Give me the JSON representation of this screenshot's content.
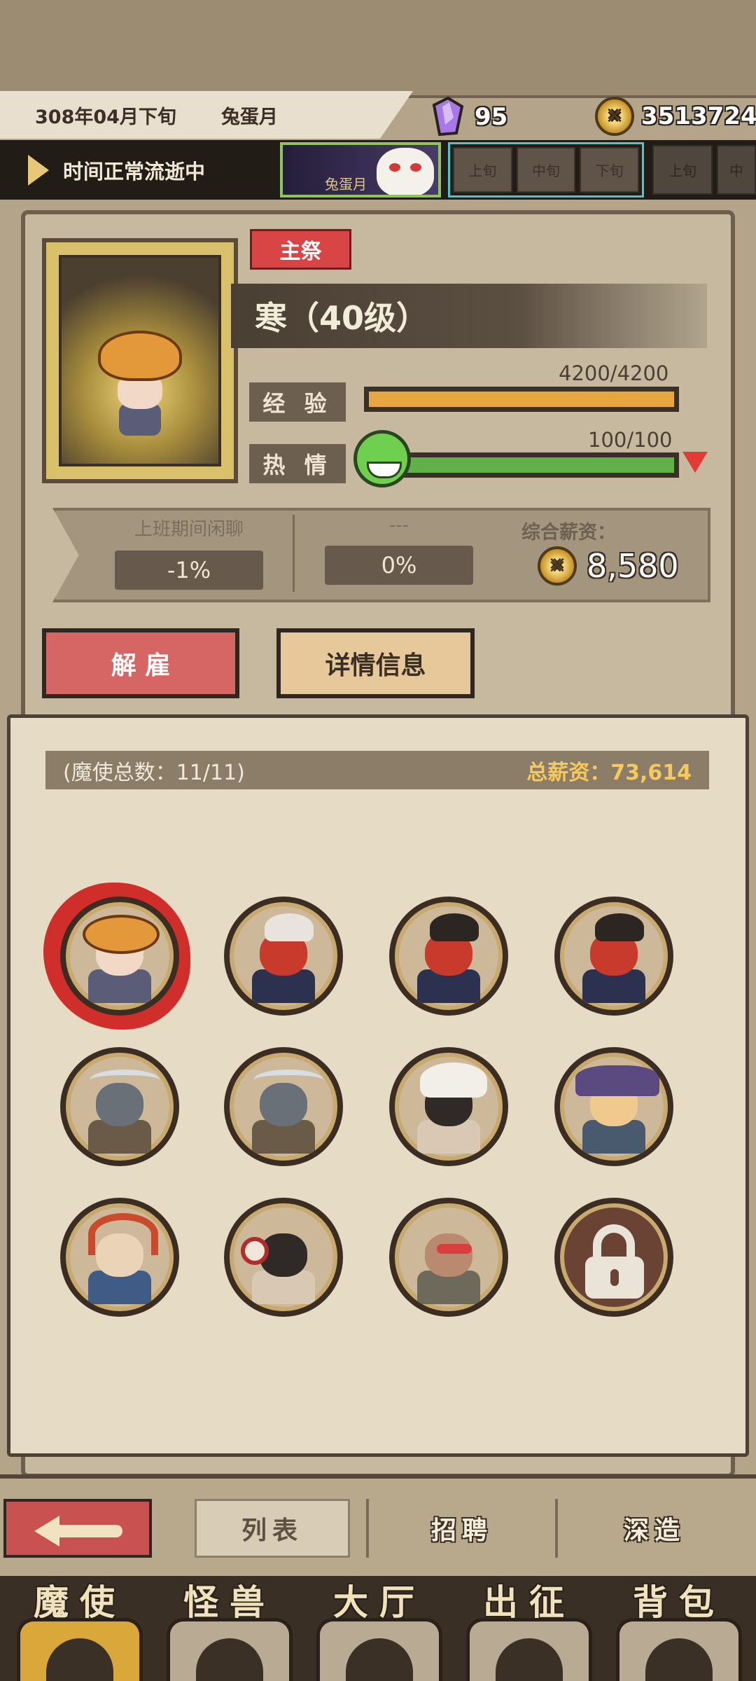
{
  "header": {
    "date": "308年04月下旬",
    "month_name": "兔蛋月",
    "crystals": "95",
    "gold": "3513724"
  },
  "timebar": {
    "status": "时间正常流逝中",
    "month_banner": "兔蛋月",
    "periods": [
      "上旬",
      "中旬",
      "下旬"
    ],
    "next_periods": [
      "上旬",
      "中"
    ]
  },
  "minion": {
    "role_badge": "主祭",
    "name": "寒（40级）",
    "exp_label": "经 验",
    "exp_value": "4200/4200",
    "exp_fraction": 1.0,
    "passion_label": "热 情",
    "passion_value": "100/100",
    "passion_fraction": 1.0,
    "trait1_label": "上班期间闲聊",
    "trait1_value": "-1%",
    "trait2_label": "---",
    "trait2_value": "0%",
    "salary_label": "综合薪资：",
    "salary_value": "8,580"
  },
  "actions": {
    "dismiss": "解 雇",
    "details": "详情信息"
  },
  "roster": {
    "count_text": "(魔使总数：11/11)",
    "total_salary": "总薪资：73,614"
  },
  "subtabs": {
    "list": "列表",
    "recruit": "招聘",
    "deep": "深造"
  },
  "nav": [
    "魔使",
    "怪兽",
    "大厅",
    "出征",
    "背包"
  ],
  "colors": {
    "exp_fill": "#e7a640",
    "passion_fill": "#62b04a",
    "accent_red": "#d94545",
    "gold_text": "#f6c95c"
  }
}
